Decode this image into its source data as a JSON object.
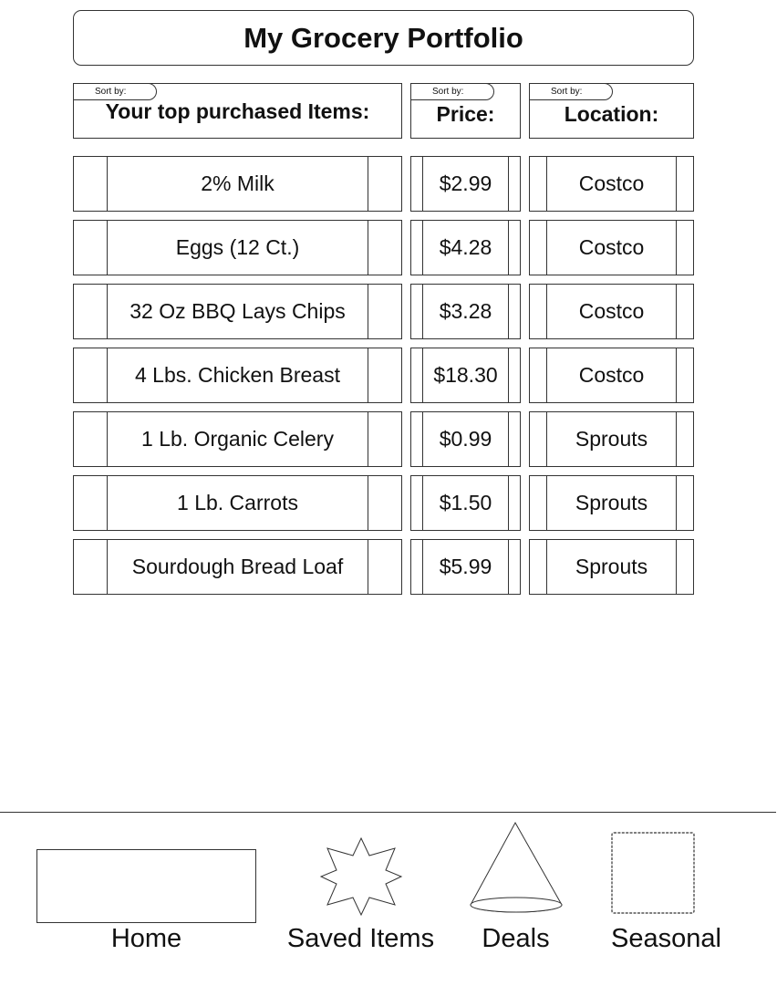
{
  "header": {
    "title": "My Grocery Portfolio"
  },
  "columns": {
    "items": {
      "sort_label": "Sort by:",
      "title": "Your top purchased Items:"
    },
    "price": {
      "sort_label": "Sort by:",
      "title": "Price:"
    },
    "location": {
      "sort_label": "Sort by:",
      "title": "Location:"
    }
  },
  "rows": [
    {
      "item": "2% Milk",
      "price": "$2.99",
      "location": "Costco"
    },
    {
      "item": "Eggs (12 Ct.)",
      "price": "$4.28",
      "location": "Costco"
    },
    {
      "item": "32 Oz BBQ Lays Chips",
      "price": "$3.28",
      "location": "Costco"
    },
    {
      "item": "4 Lbs. Chicken Breast",
      "price": "$18.30",
      "location": "Costco"
    },
    {
      "item": "1 Lb. Organic Celery",
      "price": "$0.99",
      "location": "Sprouts"
    },
    {
      "item": "1 Lb. Carrots",
      "price": "$1.50",
      "location": "Sprouts"
    },
    {
      "item": "Sourdough Bread Loaf",
      "price": "$5.99",
      "location": "Sprouts"
    }
  ],
  "nav": {
    "home": {
      "label": "Home",
      "icon": "rectangle-icon"
    },
    "saved": {
      "label": "Saved Items",
      "icon": "star-icon"
    },
    "deals": {
      "label": "Deals",
      "icon": "cone-icon"
    },
    "seasonal": {
      "label": "Seasonal",
      "icon": "wavy-frame-icon"
    }
  }
}
